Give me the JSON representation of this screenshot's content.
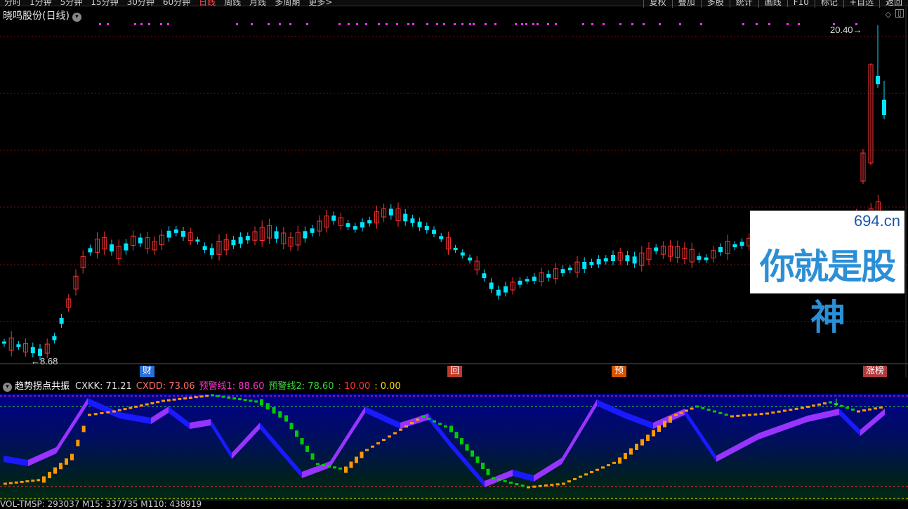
{
  "toolbar": {
    "periods": [
      "分时",
      "1分钟",
      "5分钟",
      "15分钟",
      "30分钟",
      "60分钟",
      "日线",
      "周线",
      "月线",
      "多周期",
      "更多>"
    ],
    "active_period": "日线",
    "tools": [
      "复权",
      "叠加",
      "多股",
      "统计",
      "画线",
      "F10",
      "标记",
      "+自选",
      "返回"
    ]
  },
  "stock": {
    "title": "晓鸣股份(日线)"
  },
  "price_chart": {
    "high_label": "20.40",
    "low_label": "8.68",
    "markers": [
      {
        "text": "财",
        "color": "#2a6fd6"
      },
      {
        "text": "回",
        "color": "#c0392b"
      },
      {
        "text": "预",
        "color": "#d35400"
      },
      {
        "text": "涨榜",
        "color": "#b03a3a"
      }
    ],
    "colors": {
      "up": "#ff3333",
      "down": "#00e5ff",
      "grid": "#7a1010",
      "marker_dot": "#ff33ff"
    }
  },
  "indicator": {
    "name": "趋势拐点共振",
    "values": [
      {
        "label": "CXKK: 71.21",
        "color": "#e0e0e0"
      },
      {
        "label": "CXDD: 73.06",
        "color": "#ff6a6a"
      },
      {
        "label": "预警线1: 88.60",
        "color": "#ff33cc"
      },
      {
        "label": "预警线2: 78.60",
        "color": "#33dd33"
      },
      {
        "label": ": 10.00",
        "color": "#ff3333"
      },
      {
        "label": ": 0.00",
        "color": "#ffd700"
      }
    ],
    "colors": {
      "purple": "#9933ff",
      "blue": "#1a1aff",
      "orange": "#ff9900",
      "green": "#00cc00"
    }
  },
  "bottom": {
    "text": "VOL-TMSP: 293037 M15: 337735 M110: 438919"
  },
  "watermark": {
    "url": "694.cn",
    "text": "你就是股神"
  }
}
